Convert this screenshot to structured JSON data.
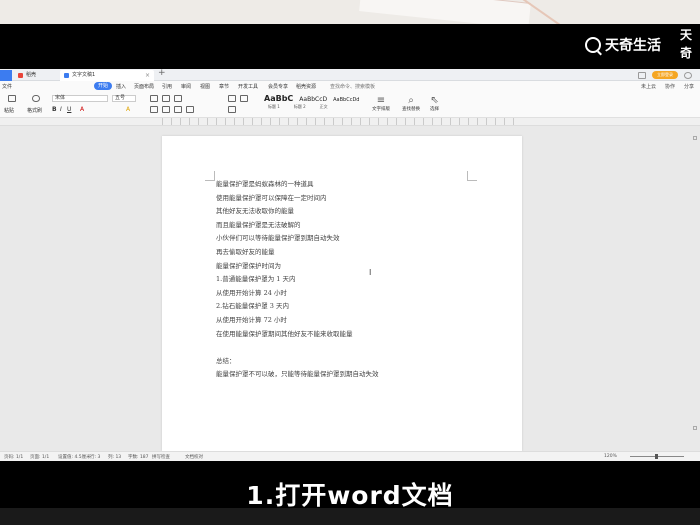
{
  "brand": {
    "name": "天奇生活",
    "seal": "天奇"
  },
  "subtitle": "1.打开word文档",
  "app": {
    "tabs": [
      {
        "label": "稻壳"
      },
      {
        "label": "文字文稿1"
      }
    ],
    "login": "立即登录",
    "menu": [
      "文件",
      "开始",
      "插入",
      "页面布局",
      "引用",
      "审阅",
      "视图",
      "章节",
      "开发工具",
      "会员专享",
      "稻壳资源"
    ],
    "active_menu": "开始",
    "search": "查找命令、搜索模板",
    "menu_right": [
      "未上云",
      "协作",
      "分享"
    ],
    "ribbon": {
      "paste": "粘贴",
      "format_painter": "格式刷",
      "font": "宋体",
      "font_size": "五号",
      "styles": [
        "AaBbC",
        "AaBbCcD",
        "AaBbCcDd"
      ],
      "style_labels": [
        "标题 1",
        "标题 2",
        "正文"
      ],
      "tools": [
        "文字排版",
        "查找替换",
        "选择"
      ]
    },
    "document": {
      "lines": [
        "能量保护罩是蚂蚁森林的一种道具",
        "使用能量保护罩可以保障在一定时间内",
        "其他好友无法收取你的能量",
        "而且能量保护罩是无法破解的",
        "小伙伴们可以等待能量保护罩到期自动失效",
        "再去偷取好友的能量",
        "能量保护罩保护时间为",
        "1.普通能量保护罩为 1 天内",
        "从使用开始计算 24 小时",
        "2.钻石能量保护罩 3 天内",
        "从使用开始计算 72 小时",
        "在使用能量保护罩期间其他好友不能来收取能量",
        "",
        "总结：",
        "能量保护罩不可以破，只能等待能量保护罩到期自动失效"
      ]
    },
    "status": {
      "page": "页码: 1/1",
      "pages": "页面: 1/1",
      "section": "设置值: 4.5厘米",
      "row": "行: 3",
      "column": "列: 13",
      "words": "字数: 187",
      "spell": "拼写检查",
      "proofread": "文档校对",
      "zoom": "120%"
    }
  }
}
